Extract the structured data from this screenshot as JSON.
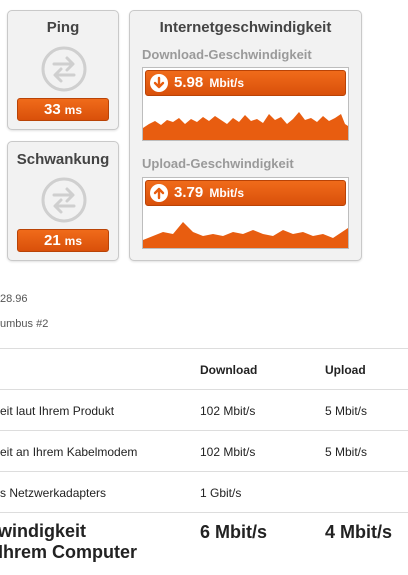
{
  "ping": {
    "title": "Ping",
    "value": "33",
    "unit": "ms"
  },
  "jitter": {
    "title": "Schwankung",
    "value": "21",
    "unit": "ms"
  },
  "speed_card": {
    "title": "Internetgeschwindigkeit",
    "download": {
      "title": "Download-Geschwindigkeit",
      "value": "5.98",
      "unit": "Mbit/s"
    },
    "upload": {
      "title": "Upload-Geschwindigkeit",
      "value": "3.79",
      "unit": "Mbit/s"
    }
  },
  "meta": {
    "line1": "28.96",
    "line2": "umbus #2"
  },
  "table": {
    "headers": {
      "download": "Download",
      "upload": "Upload"
    },
    "rows": [
      {
        "label": "eit laut Ihrem Produkt",
        "download": "102 Mbit/s",
        "upload": "5 Mbit/s"
      },
      {
        "label": "eit an Ihrem Kabelmodem",
        "download": "102 Mbit/s",
        "upload": "5 Mbit/s"
      },
      {
        "label": "s Netzwerkadapters",
        "download": "1 Gbit/s",
        "upload": ""
      }
    ],
    "total": {
      "label_line1": "windigkeit",
      "label_line2": "Ihrem Computer",
      "download": "6 Mbit/s",
      "upload": "4 Mbit/s"
    }
  },
  "colors": {
    "accent": "#e85d10",
    "icon_gray": "#cfcfcf"
  }
}
